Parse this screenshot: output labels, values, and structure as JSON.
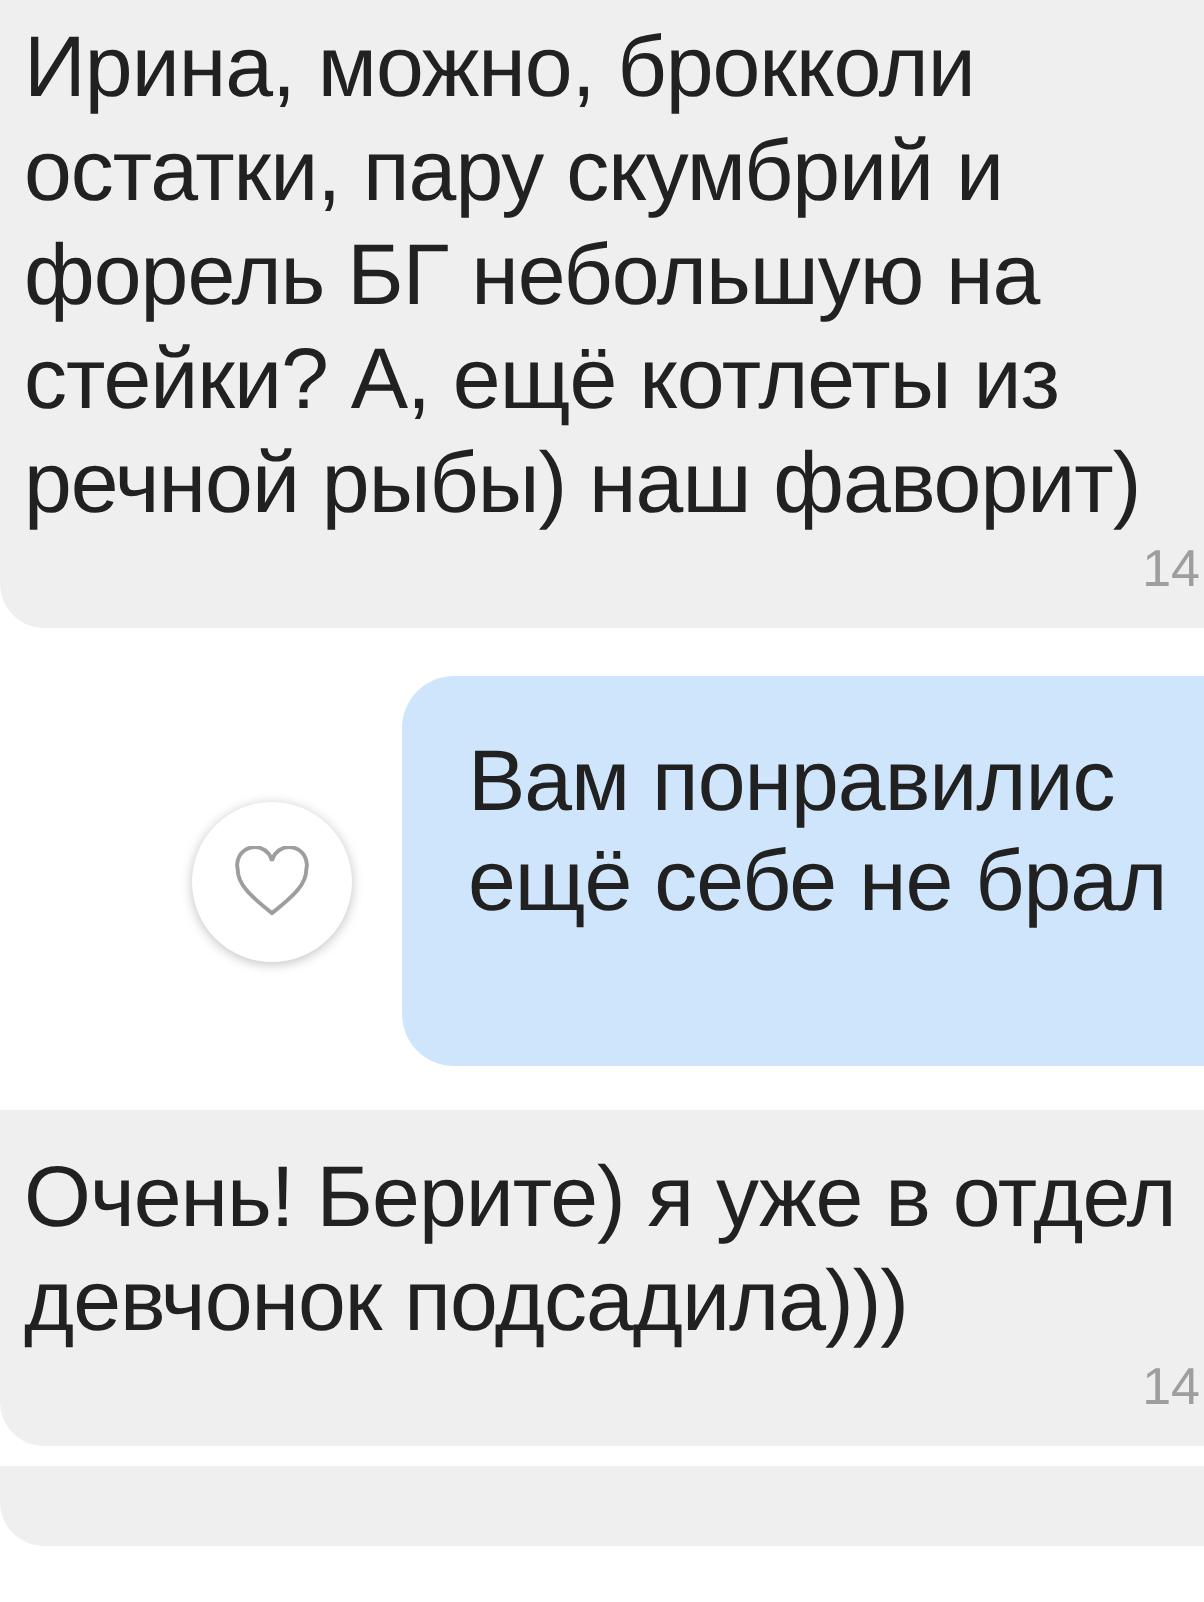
{
  "messages": [
    {
      "kind": "incoming",
      "text": "Ирина, можно, брокколи\nостатки, пару скумбрий и\nфорель БГ небольшую на\nстейки? А, ещё котлеты из\nречной рыбы) наш фаворит)",
      "time": "14"
    },
    {
      "kind": "outgoing",
      "text": "Вам понравилис\nещё себе не брал",
      "liked": false
    },
    {
      "kind": "incoming",
      "text": "Очень! Берите) я уже в отдел\nдевчонок подсадила)))",
      "time": "14"
    },
    {
      "kind": "incoming"
    }
  ]
}
